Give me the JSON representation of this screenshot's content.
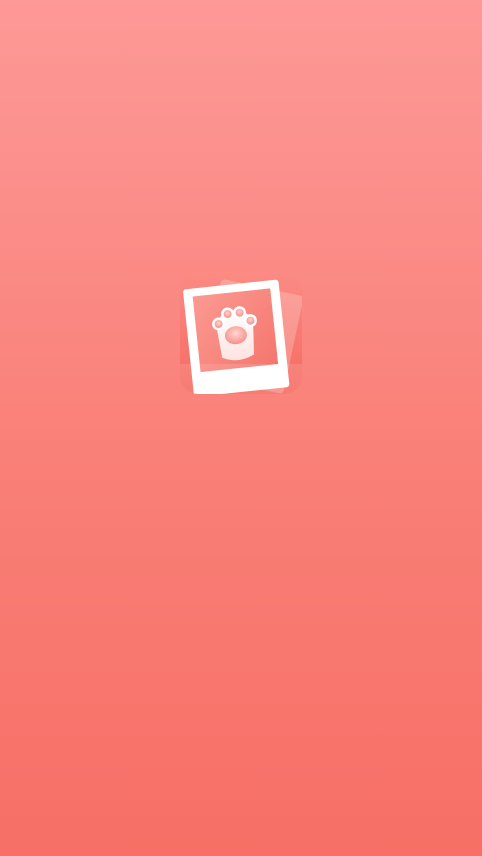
{
  "screen": {
    "type": "splash",
    "background_top": "#fd9997",
    "background_bottom": "#f76f66"
  },
  "logo": {
    "icon": "paw-photo-icon",
    "tile_color": "#f6736a",
    "frame_color": "#ffffff",
    "photo_color": "#f8857d"
  }
}
